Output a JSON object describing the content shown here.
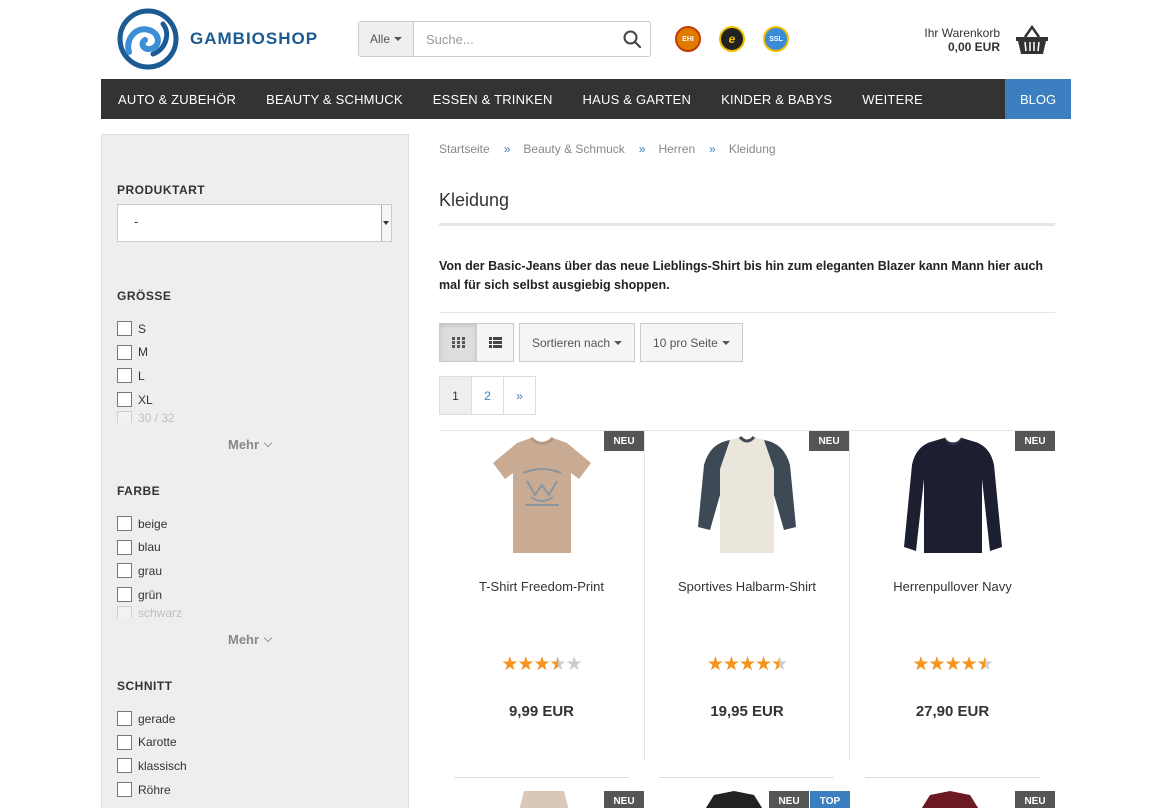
{
  "header": {
    "logo_text": "GAMBIOSHOP",
    "search": {
      "category": "Alle",
      "placeholder": "Suche..."
    },
    "seals": [
      {
        "name": "ehi-seal",
        "label": "EHI"
      },
      {
        "name": "trusted-shops-seal",
        "label": "e"
      },
      {
        "name": "ssl-seal",
        "label": "SSL"
      }
    ],
    "cart": {
      "label": "Ihr Warenkorb",
      "total": "0,00 EUR"
    }
  },
  "nav": {
    "items": [
      "AUTO & ZUBEHÖR",
      "BEAUTY & SCHMUCK",
      "ESSEN & TRINKEN",
      "HAUS & GARTEN",
      "KINDER & BABYS",
      "WEITERE"
    ],
    "blog": "BLOG"
  },
  "sidebar": {
    "produktart": {
      "title": "PRODUKTART",
      "value": "-"
    },
    "groesse": {
      "title": "GRÖSSE",
      "options": [
        "S",
        "M",
        "L",
        "XL"
      ],
      "faded": "30 / 32",
      "more": "Mehr"
    },
    "farbe": {
      "title": "FARBE",
      "options": [
        "beige",
        "blau",
        "grau",
        "grün"
      ],
      "faded": "schwarz",
      "more": "Mehr"
    },
    "schnitt": {
      "title": "SCHNITT",
      "options": [
        "gerade",
        "Karotte",
        "klassisch",
        "Röhre"
      ]
    }
  },
  "breadcrumb": [
    "Startseite",
    "Beauty & Schmuck",
    "Herren",
    "Kleidung"
  ],
  "breadcrumb_sep": "»",
  "page_title": "Kleidung",
  "description": "Von der Basic-Jeans über das neue Lieblings-Shirt bis hin zum eleganten Blazer kann Mann hier auch mal für sich selbst ausgiebig shoppen.",
  "toolbar": {
    "sort": "Sortieren nach",
    "per_page": "10 pro Seite"
  },
  "pagination": [
    "1",
    "2",
    "»"
  ],
  "products": [
    {
      "name": "T-Shirt Freedom-Print",
      "price": "9,99 EUR",
      "rating": 3.5,
      "badge": "NEU",
      "color": "#c9ab94",
      "type": "tshirt"
    },
    {
      "name": "Sportives Halbarm-Shirt",
      "price": "19,95 EUR",
      "rating": 4.5,
      "badge": "NEU",
      "color": "#ebe6dc",
      "type": "raglan"
    },
    {
      "name": "Herrenpullover Navy",
      "price": "27,90 EUR",
      "rating": 4.5,
      "badge": "NEU",
      "color": "#1c1f30",
      "type": "longsleeve"
    }
  ],
  "products_row2": [
    {
      "badges": [
        "NEU"
      ]
    },
    {
      "badges": [
        "NEU",
        "TOP"
      ]
    },
    {
      "badges": [
        "NEU"
      ]
    }
  ]
}
